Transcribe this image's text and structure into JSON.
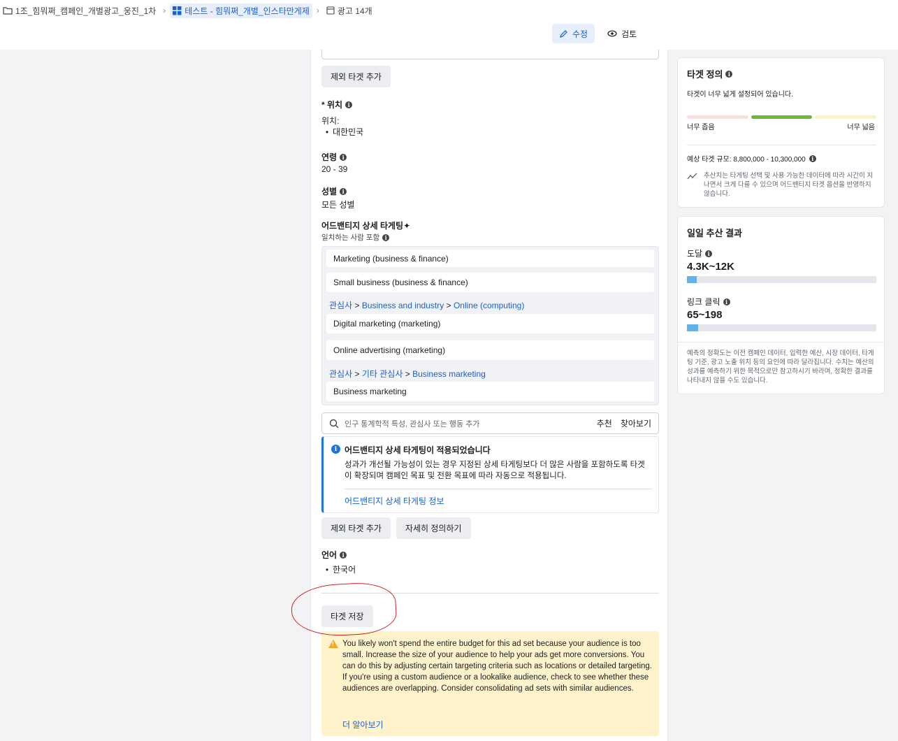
{
  "breadcrumb": {
    "campaign": "1조_힘뭐쩌_캠페인_개별광고_웅진_1차",
    "adset": "테스트 - 힘뭐쩌_개별_인스타만게제",
    "ads": "광고 14개"
  },
  "toolbar": {
    "edit_label": "수정",
    "review_label": "검토"
  },
  "audience": {
    "top_search_placeholder": "",
    "exclude_button_top": "제외 타겟 추가",
    "location_label": "* 위치",
    "location_sub": "위치:",
    "location_value": "대한민국",
    "age_label": "연령",
    "age_value": "20 - 39",
    "gender_label": "성별",
    "gender_value": "모든 성별",
    "detail_label": "어드밴티지 상세 타게팅✦",
    "detail_sub": "일치하는 사람 포함",
    "items": [
      "Marketing (business & finance)",
      "Small business (business & finance)",
      "Digital marketing (marketing)",
      "Online advertising (marketing)",
      "Business marketing"
    ],
    "path1": {
      "a": "관심사",
      "b": "Business and industry",
      "c": "Online (computing)"
    },
    "path2": {
      "a": "관심사",
      "b": "기타 관심사",
      "c": "Business marketing"
    },
    "sep": ">",
    "search_placeholder": "인구 통계학적 특성, 관심사 또는 행동 추가",
    "suggest": "추천",
    "browse": "찾아보기",
    "notice_title": "어드밴티지 상세 타게팅이 적용되었습니다",
    "notice_body": "성과가 개선될 가능성이 있는 경우 지정된 상세 타게팅보다 더 많은 사람을 포함하도록 타겟이 확장되며 캠페인 목표 및 전환 목표에 따라 자동으로 적용됩니다.",
    "notice_link": "어드밴티지 상세 타게팅 정보",
    "exclude_button": "제외 타겟 추가",
    "define_button": "자세히 정의하기",
    "language_label": "언어",
    "language_value": "한국어",
    "save_button": "타겟 저장",
    "warning_text_1": "You likely won't spend the entire budget for this ad set because your audience is too small. Increase the size of your audience to help your ads get more conversions. You can do this by adjusting certain targeting criteria such as locations or detailed targeting.",
    "warning_text_2": "If you're using a custom audience or a lookalike audience, check to see whether these audiences are overlapping. Consider consolidating ad sets with similar audiences.",
    "warning_link": "더 알아보기"
  },
  "definition": {
    "title": "타겟 정의",
    "status": "타겟이 너무 넓게 설정되어 있습니다.",
    "narrow": "너무 좁음",
    "broad": "너무 넓음",
    "estimated": "예상 타겟 규모: 8,800,000 - 10,300,000",
    "note": "추산치는 타게팅 선택 및 사용 가능한 데이터에 따라 시간이 지나면서 크게 다를 수 있으며 어드밴티지 타겟 옵션을 반영하지 않습니다.",
    "colors": {
      "narrow": "#f9e0dc",
      "good": "#6ab934",
      "broad": "#fdf0c2"
    }
  },
  "daily": {
    "title": "일일 추산 결과",
    "reach_label": "도달",
    "reach_value": "4.3K~12K",
    "reach_fill": 0.05,
    "click_label": "링크 클릭",
    "click_value": "65~198",
    "click_fill": 0.06,
    "disclaimer": "예측의 정확도는 이전 캠페인 데이터, 입력한 예산, 시장 데이터, 타게팅 기준, 광고 노출 위치 등의 요인에 따라 달라집니다. 수치는 예산의 성과를 예측하기 위한 목적으로만 참고하시기 바라며, 정확한 결과를 나타내지 않을 수도 있습니다."
  }
}
